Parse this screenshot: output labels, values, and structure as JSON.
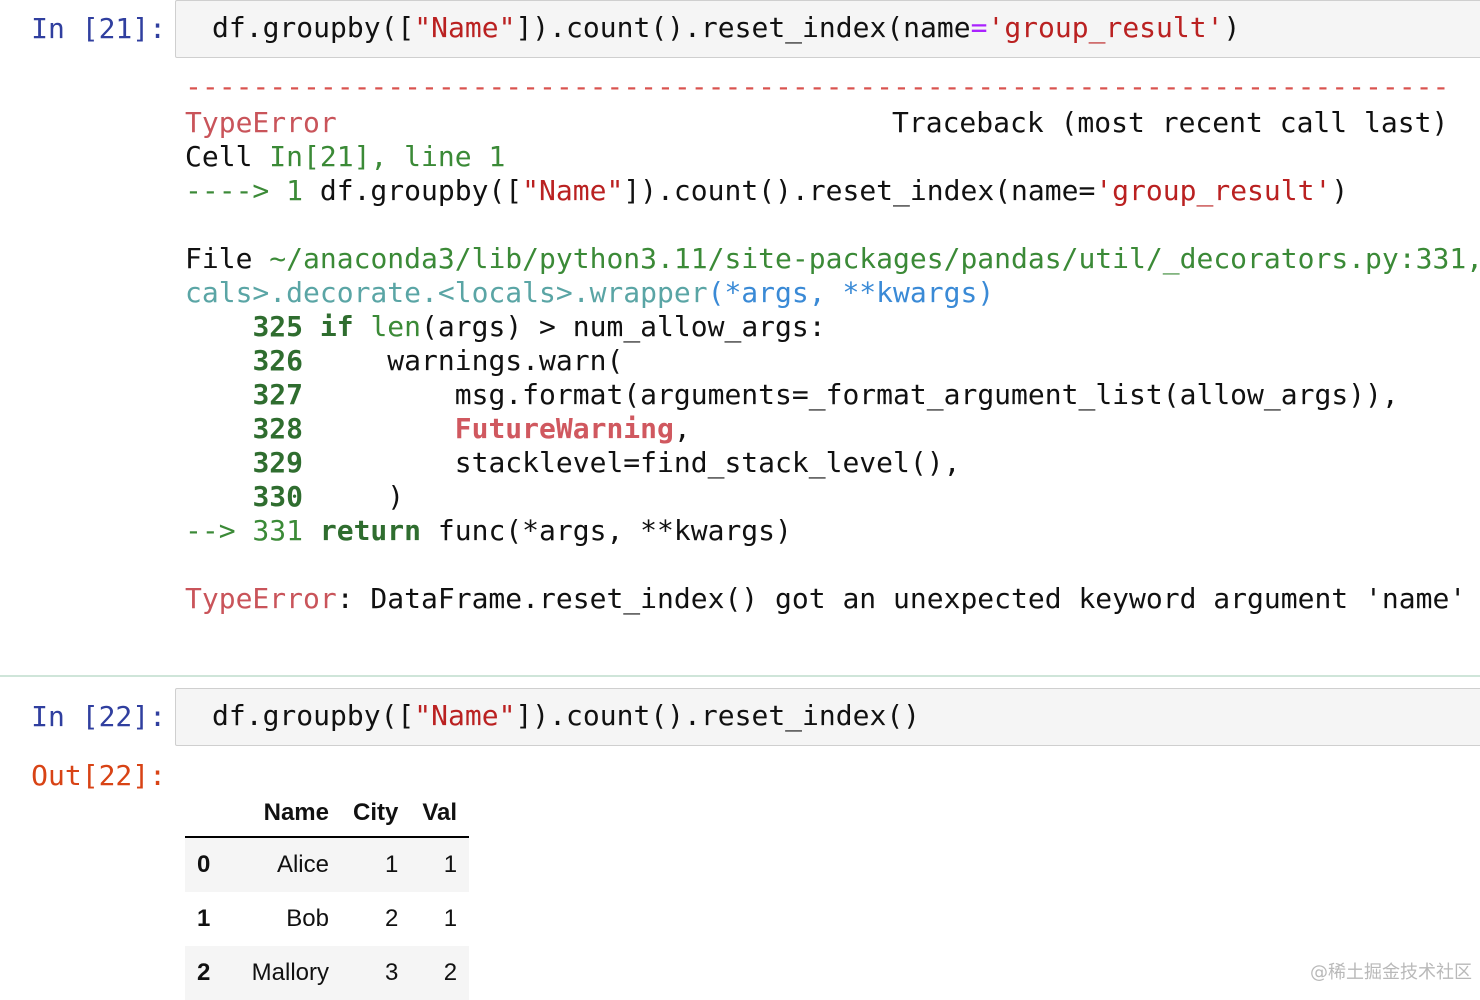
{
  "cell21": {
    "prompt": "In [21]:",
    "code": {
      "p1": "df.groupby([",
      "s1": "\"Name\"",
      "p2": "]).count().reset_index(name",
      "eq": "=",
      "s2": "'group_result'",
      "p3": ")"
    },
    "error": {
      "dashes": "--------------------------------------------------------------------------------------------------------",
      "type_name": "TypeError",
      "traceback_label": "Traceback (most recent call last)",
      "cell_label": "Cell ",
      "cell_ref": "In[21], line 1",
      "arrow1": "----> 1 ",
      "arrow1_code_a": "df.groupby([",
      "arrow1_code_s": "\"Name\"",
      "arrow1_code_b": "]).count().reset_index(name=",
      "arrow1_code_s2": "'group_result'",
      "arrow1_code_c": ")",
      "file_label": "File ",
      "file_path": "~/anaconda3/lib/python3.11/site-packages/pandas/util/_decorators.py:331,",
      "frame_name": "cals>.decorate.<locals>.wrapper",
      "frame_args": "(*args, **kwargs)",
      "lines": [
        {
          "num": "325",
          "a": " if",
          "b": " len",
          "c": "(args) > num_allow_args:"
        },
        {
          "num": "326",
          "a": "     warnings.warn("
        },
        {
          "num": "327",
          "a": "         msg.format(arguments=_format_argument_list(allow_args)),"
        },
        {
          "num": "328",
          "a": "         ",
          "b": "FutureWarning",
          "c": ","
        },
        {
          "num": "329",
          "a": "         stacklevel=find_stack_level(),"
        },
        {
          "num": "330",
          "a": "     )"
        }
      ],
      "arrow2": "--> 331 ",
      "return_kw": "return",
      "return_rest": " func(*args, **kwargs)",
      "final_type": "TypeError",
      "final_msg": ": DataFrame.reset_index() got an unexpected keyword argument 'name'"
    }
  },
  "cell22": {
    "prompt": "In [22]:",
    "out_prompt": "Out[22]:",
    "code": {
      "p1": "df.groupby([",
      "s1": "\"Name\"",
      "p2": "]).count().reset_index()"
    },
    "table": {
      "columns": [
        "Name",
        "City",
        "Val"
      ],
      "rows": [
        {
          "index": "0",
          "cells": [
            "Alice",
            "1",
            "1"
          ]
        },
        {
          "index": "1",
          "cells": [
            "Bob",
            "2",
            "1"
          ]
        },
        {
          "index": "2",
          "cells": [
            "Mallory",
            "3",
            "2"
          ]
        }
      ]
    }
  },
  "watermark": "@稀土掘金技术社区"
}
